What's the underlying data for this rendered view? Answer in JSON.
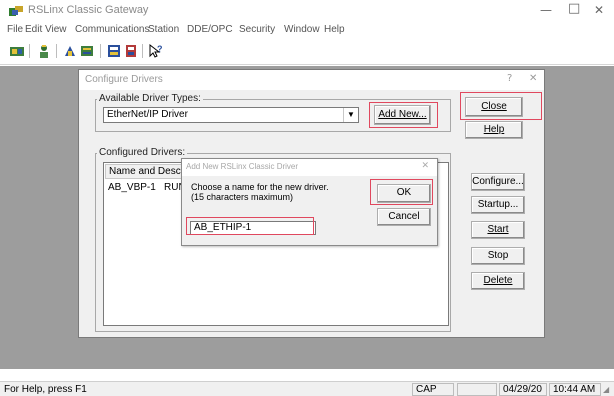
{
  "window": {
    "title": "RSLinx Classic Gateway",
    "minimize_icon": "minimize-icon",
    "maximize_icon": "maximize-icon",
    "close_icon": "close-icon"
  },
  "menu": [
    "File",
    "Edit",
    "View",
    "Communications",
    "Station",
    "DDE/OPC",
    "Security",
    "Window",
    "Help"
  ],
  "toolbar": {
    "icons": [
      "network-icon",
      "rswho-icon",
      "configure-drivers-icon",
      "configure-shortcuts-icon",
      "topic-icon",
      "driver-icon",
      "help-pointer-icon"
    ]
  },
  "configure_drivers": {
    "title": "Configure Drivers",
    "help_icon": "question-icon",
    "close_icon": "close-icon",
    "available_label": "Available Driver Types:",
    "selected_driver": "EtherNet/IP Driver",
    "add_new_label": "Add New...",
    "close_label": "Close",
    "help_label": "Help",
    "configured_label": "Configured Drivers:",
    "column_header": "Name and Description",
    "drivers": [
      {
        "name": "AB_VBP-1",
        "status": "RUN"
      }
    ],
    "configure_label": "Configure...",
    "startup_label": "Startup...",
    "start_label": "Start",
    "stop_label": "Stop",
    "delete_label": "Delete",
    "highlight_color": "#e0485e"
  },
  "add_new_dialog": {
    "title": "Add New RSLinx Classic Driver",
    "prompt_line1": "Choose a name for the new driver.",
    "prompt_line2": "(15 characters maximum)",
    "name_value": "AB_ETHIP-1",
    "ok_label": "OK",
    "cancel_label": "Cancel"
  },
  "statusbar": {
    "help_text": "For Help, press F1",
    "cap": "CAP",
    "date": "04/29/20",
    "time": "10:44 AM"
  }
}
